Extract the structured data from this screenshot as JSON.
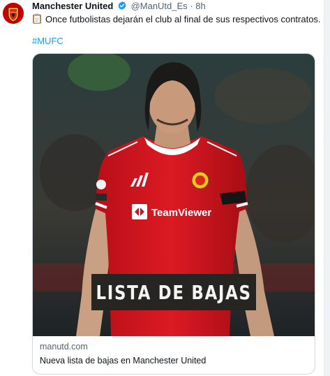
{
  "tweet": {
    "author_name": "Manchester United",
    "handle": "@ManUtd_Es",
    "separator": "·",
    "time": "8h",
    "text": "Once futbolistas dejarán el club al final de sus respectivos contratos.",
    "hashtag": "#MUFC",
    "icons": [
      "club-crest-icon",
      "verified-badge-icon",
      "clipboard-emoji-icon"
    ]
  },
  "card": {
    "domain": "manutd.com",
    "title": "Nueva lista de bajas en Manchester United",
    "image_overlay": "LISTA DE BAJAS",
    "shirt_sponsor": "TeamViewer"
  },
  "colors": {
    "accent": "#1d9bf0",
    "kit_red": "#d7141e",
    "overlay_bg": "#262522",
    "secondary_text": "#536471"
  }
}
